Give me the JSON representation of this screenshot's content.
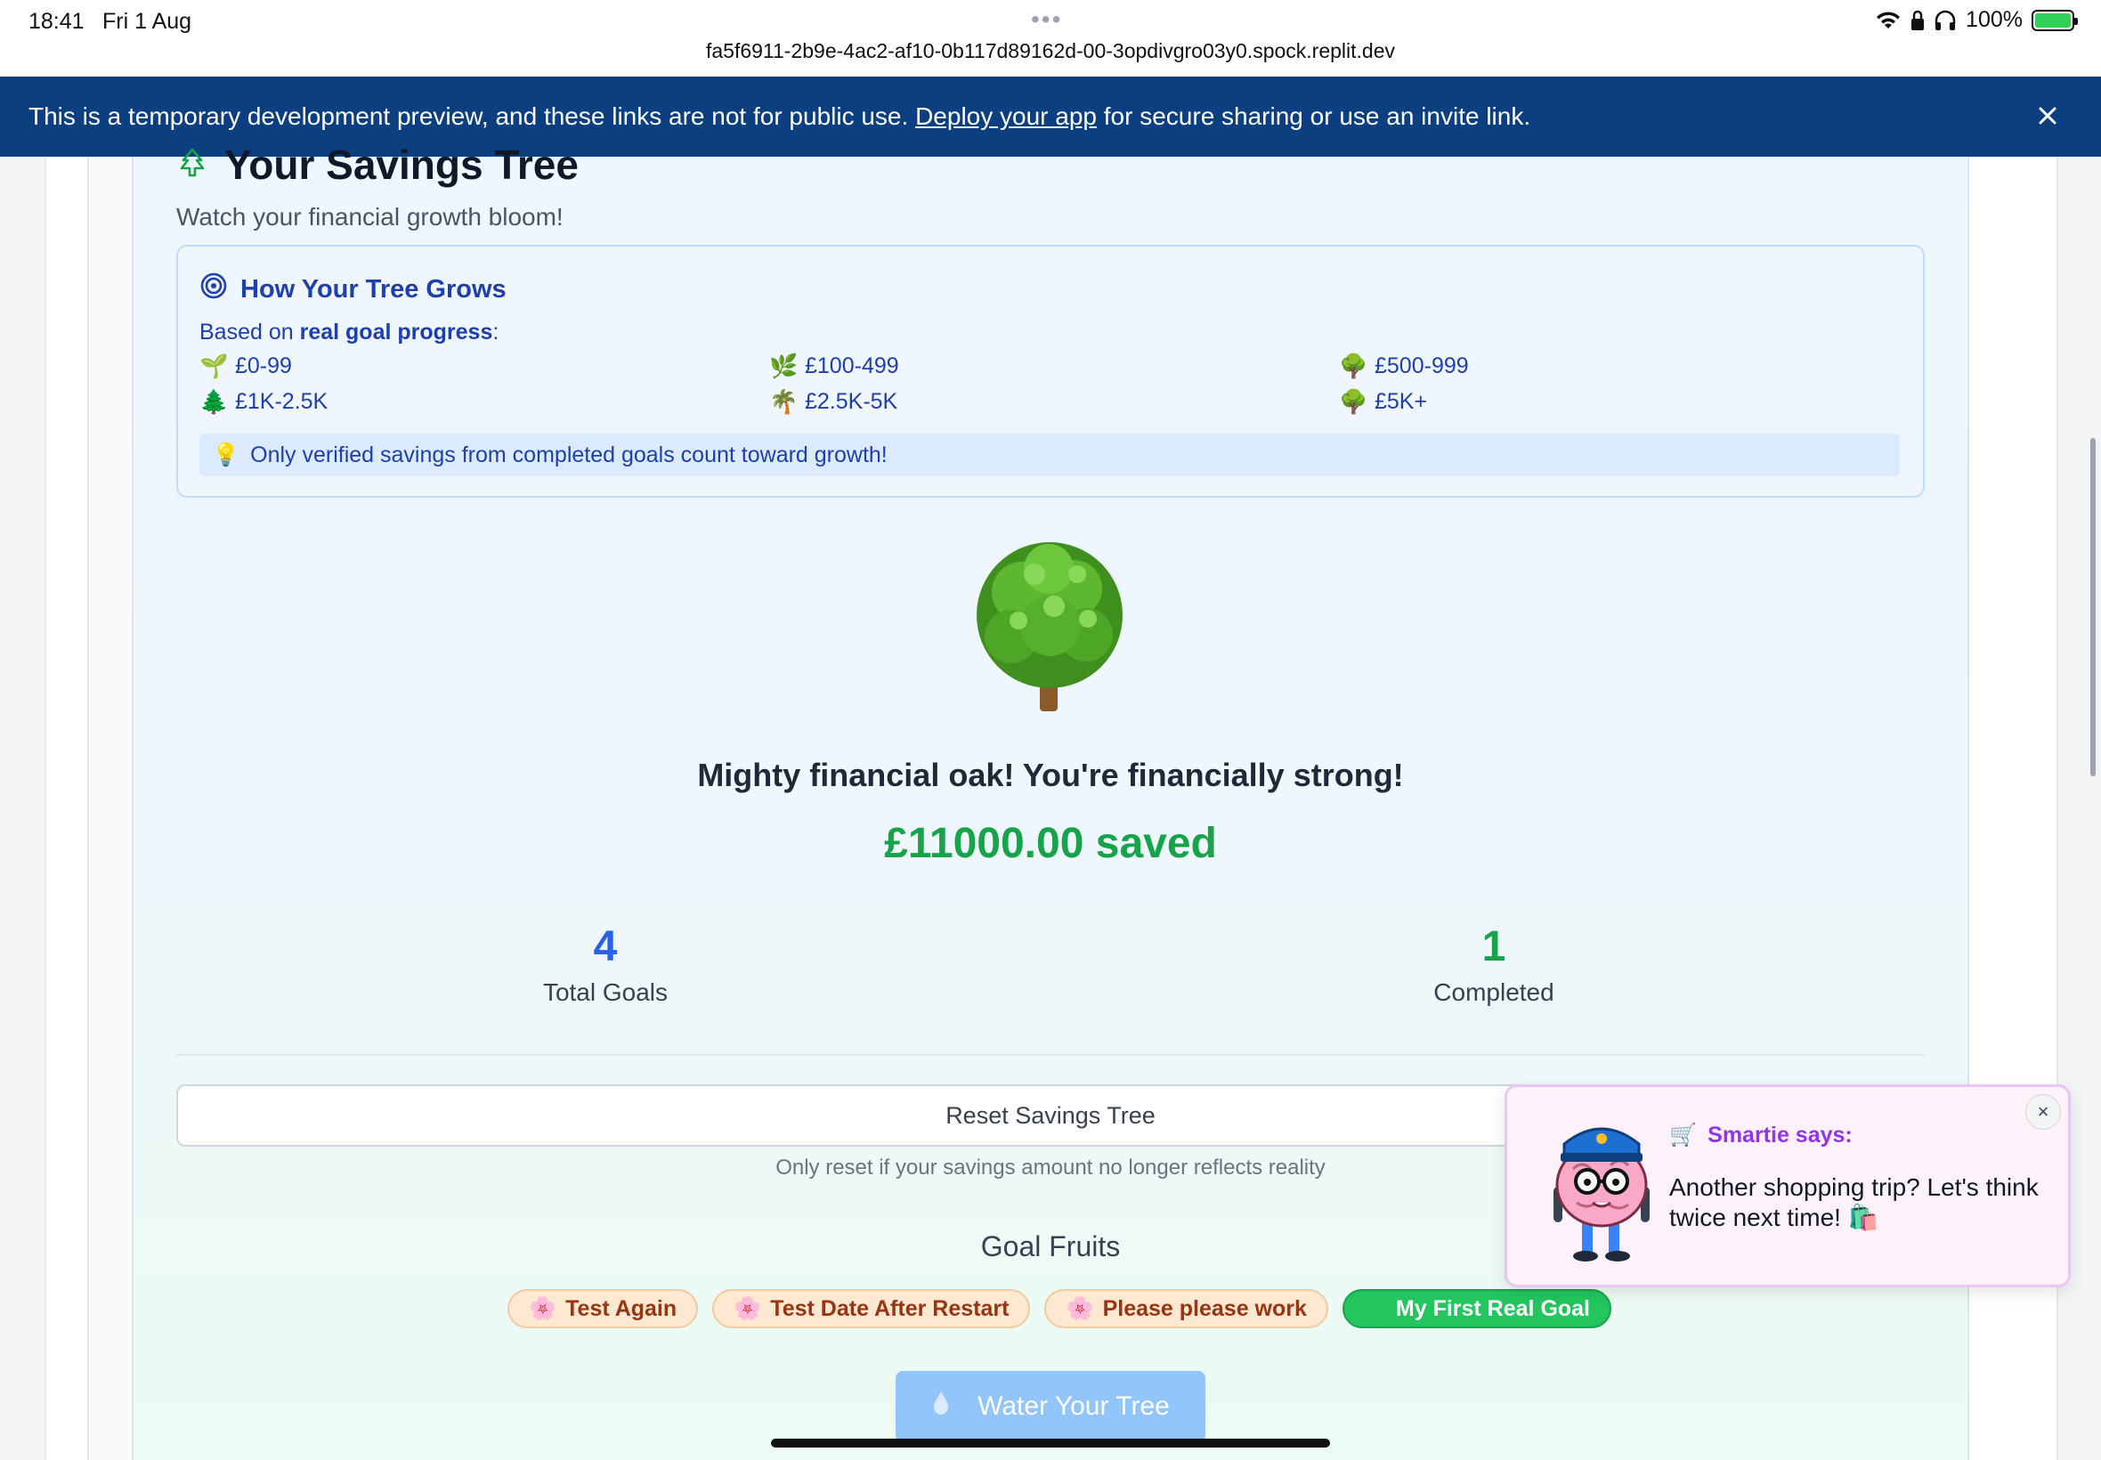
{
  "status_bar": {
    "time": "18:41",
    "date": "Fri 1 Aug",
    "url": "fa5f6911-2b9e-4ac2-af10-0b117d89162d-00-3opdivgro03y0.spock.replit.dev",
    "battery": "100%"
  },
  "dev_banner": {
    "text_before": "This is a temporary development preview, and these links are not for public use. ",
    "link_label": "Deploy your app",
    "text_after": " for secure sharing or use an invite link."
  },
  "savings_tree": {
    "title": "Your Savings Tree",
    "subtitle": "Watch your financial growth bloom!",
    "how_title": "How Your Tree Grows",
    "based_prefix": "Based on ",
    "based_bold": "real goal progress",
    "based_suffix": ":",
    "tiers": [
      {
        "emoji": "🌱",
        "label": "£0-99"
      },
      {
        "emoji": "🌿",
        "label": "£100-499"
      },
      {
        "emoji": "🌳",
        "label": "£500-999"
      },
      {
        "emoji": "🌲",
        "label": "£1K-2.5K"
      },
      {
        "emoji": "🌴",
        "label": "£2.5K-5K"
      },
      {
        "emoji": "🌳",
        "label": "£5K+"
      }
    ],
    "tip": "Only verified savings from completed goals count toward growth!",
    "message": "Mighty financial oak! You're financially strong!",
    "amount": "£11000.00 saved",
    "stats": {
      "total_value": "4",
      "total_label": "Total Goals",
      "completed_value": "1",
      "completed_label": "Completed"
    },
    "reset_label": "Reset Savings Tree",
    "reset_note": "Only reset if your savings amount no longer reflects reality",
    "fruits_title": "Goal Fruits",
    "fruits": [
      {
        "emoji": "🌸",
        "label": "Test Again",
        "state": "pending"
      },
      {
        "emoji": "🌸",
        "label": "Test Date After Restart",
        "state": "pending"
      },
      {
        "emoji": "🌸",
        "label": "Please please work",
        "state": "pending"
      },
      {
        "emoji": "",
        "label": "My First Real Goal",
        "state": "done"
      }
    ],
    "water_label": "Water Your Tree"
  },
  "toast": {
    "who": "Smartie says:",
    "message": "Another shopping trip? Let's think twice next time! 🛍️",
    "close": "×"
  },
  "colors": {
    "banner": "#0c3f7f",
    "accent_blue": "#2563eb",
    "accent_green": "#16a34a",
    "toast_purple": "#9333ea"
  }
}
